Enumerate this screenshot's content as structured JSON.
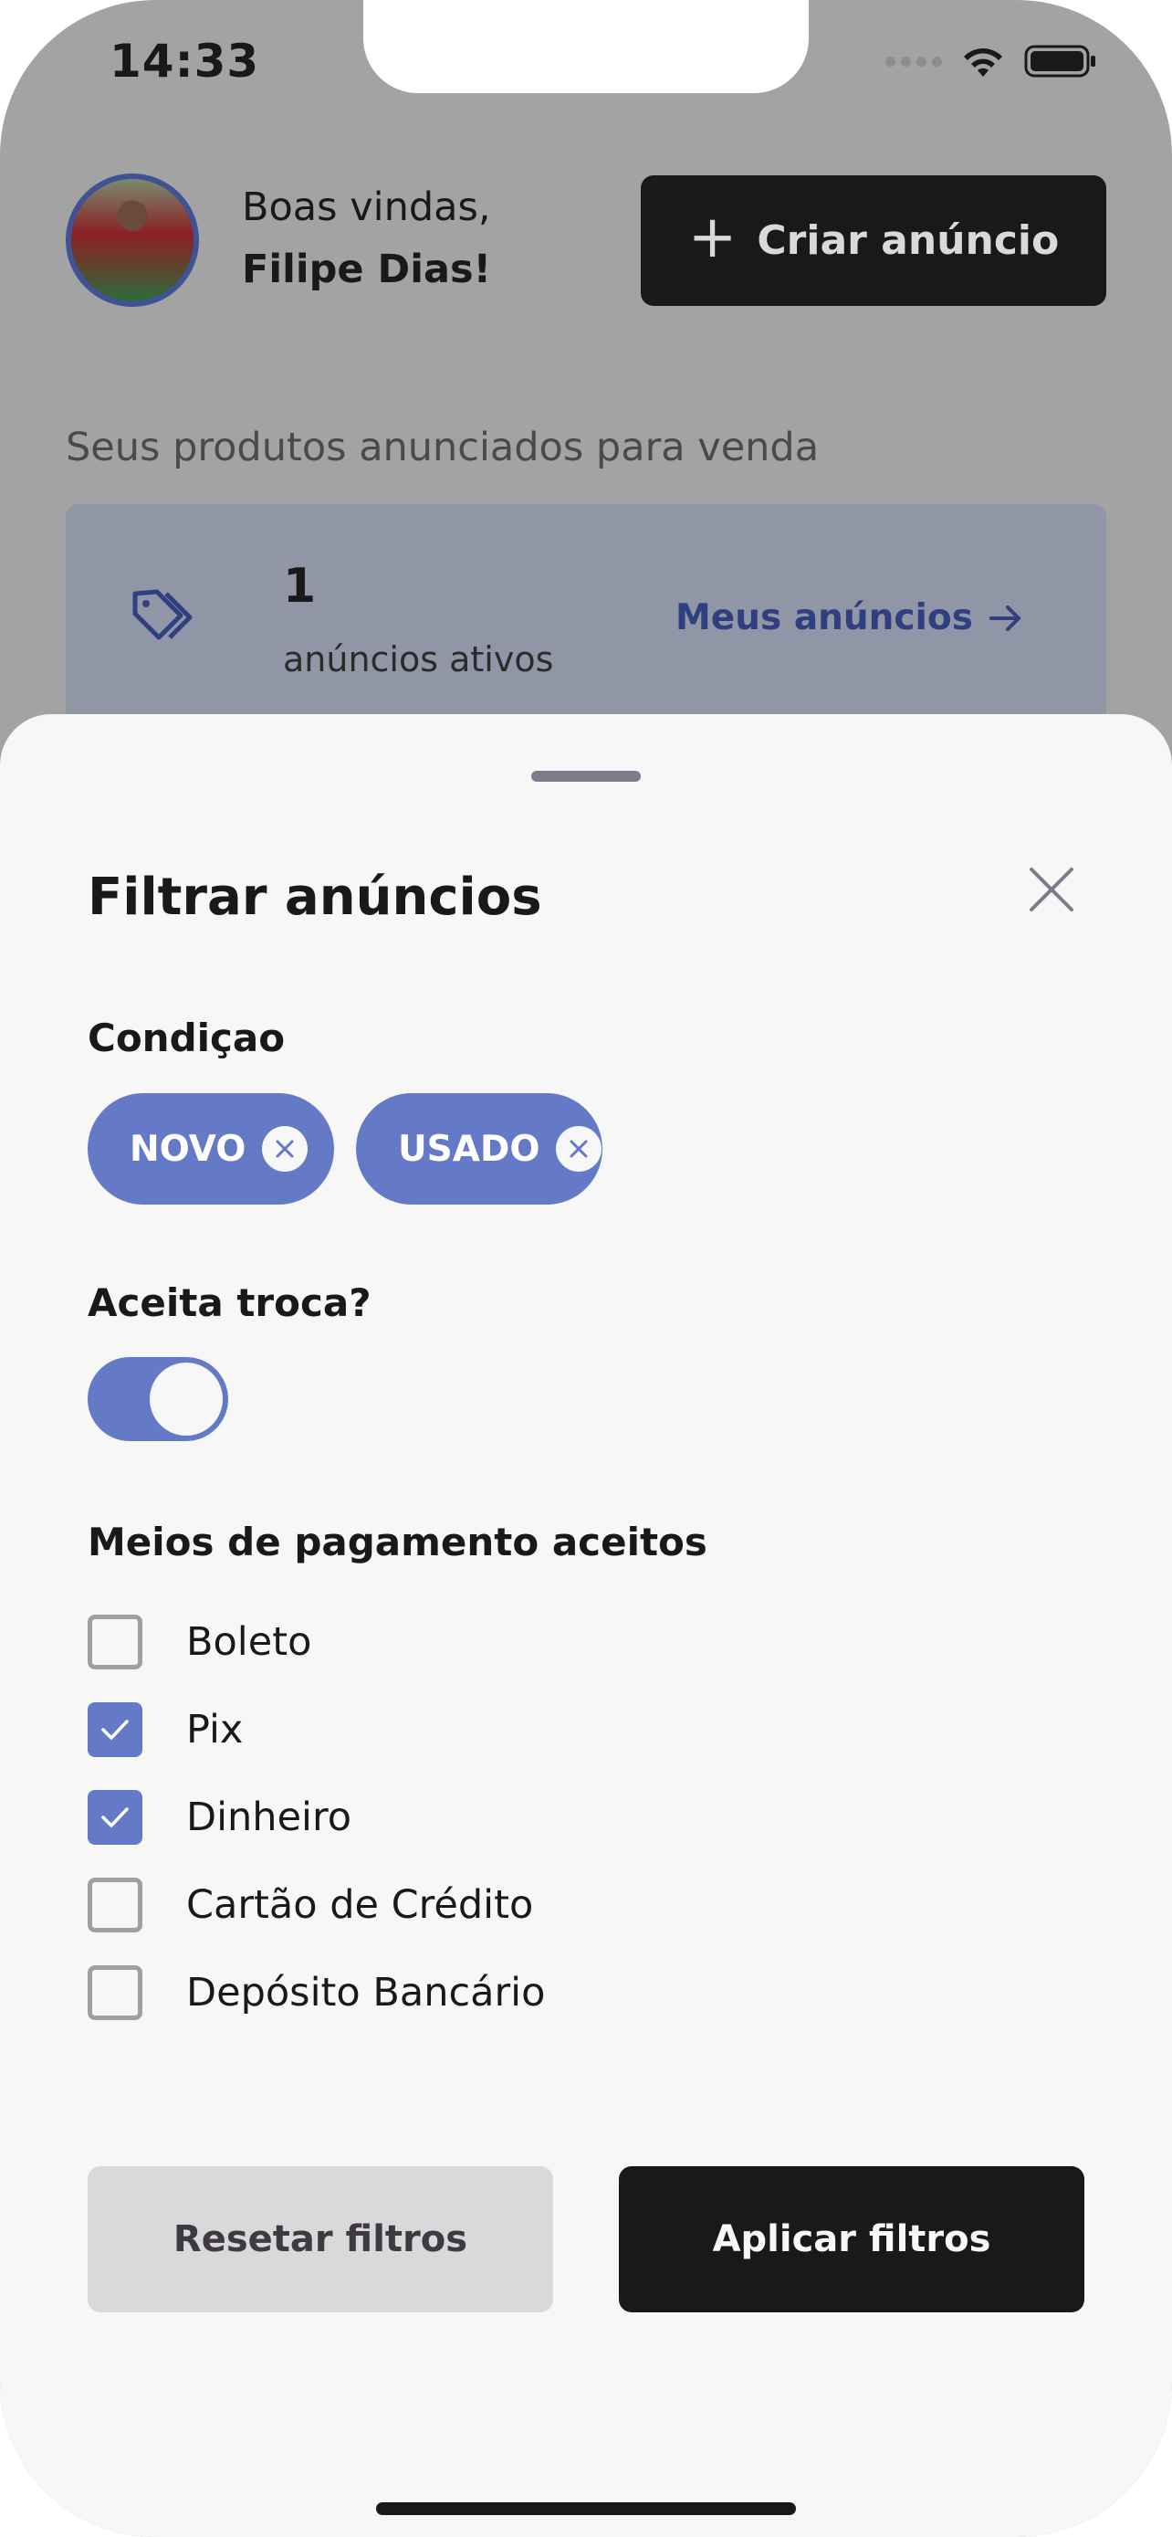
{
  "status_bar": {
    "time": "14:33"
  },
  "header": {
    "greeting": "Boas vindas,",
    "user_name": "Filipe Dias!",
    "create_button_label": "Criar anúncio"
  },
  "products": {
    "section_label": "Seus produtos anunciados para venda",
    "active_count": "1",
    "active_label": "anúncios ativos",
    "my_ads_link": "Meus anúncios"
  },
  "filter_sheet": {
    "title": "Filtrar anúncios",
    "condition": {
      "label": "Condiçao",
      "chips": [
        {
          "label": "NOVO",
          "selected": true
        },
        {
          "label": "USADO",
          "selected": true
        }
      ]
    },
    "trade": {
      "label": "Aceita troca?",
      "enabled": true
    },
    "payment": {
      "label": "Meios de pagamento aceitos",
      "options": [
        {
          "label": "Boleto",
          "checked": false
        },
        {
          "label": "Pix",
          "checked": true
        },
        {
          "label": "Dinheiro",
          "checked": true
        },
        {
          "label": "Cartão de Crédito",
          "checked": false
        },
        {
          "label": "Depósito Bancário",
          "checked": false
        }
      ]
    },
    "reset_label": "Resetar filtros",
    "apply_label": "Aplicar filtros"
  },
  "colors": {
    "accent": "#647AC7",
    "accent_dark": "#3F5294",
    "dark": "#1A181B",
    "sheet_bg": "#F7F7F8",
    "overlay_bg": "#A3A3A3"
  }
}
